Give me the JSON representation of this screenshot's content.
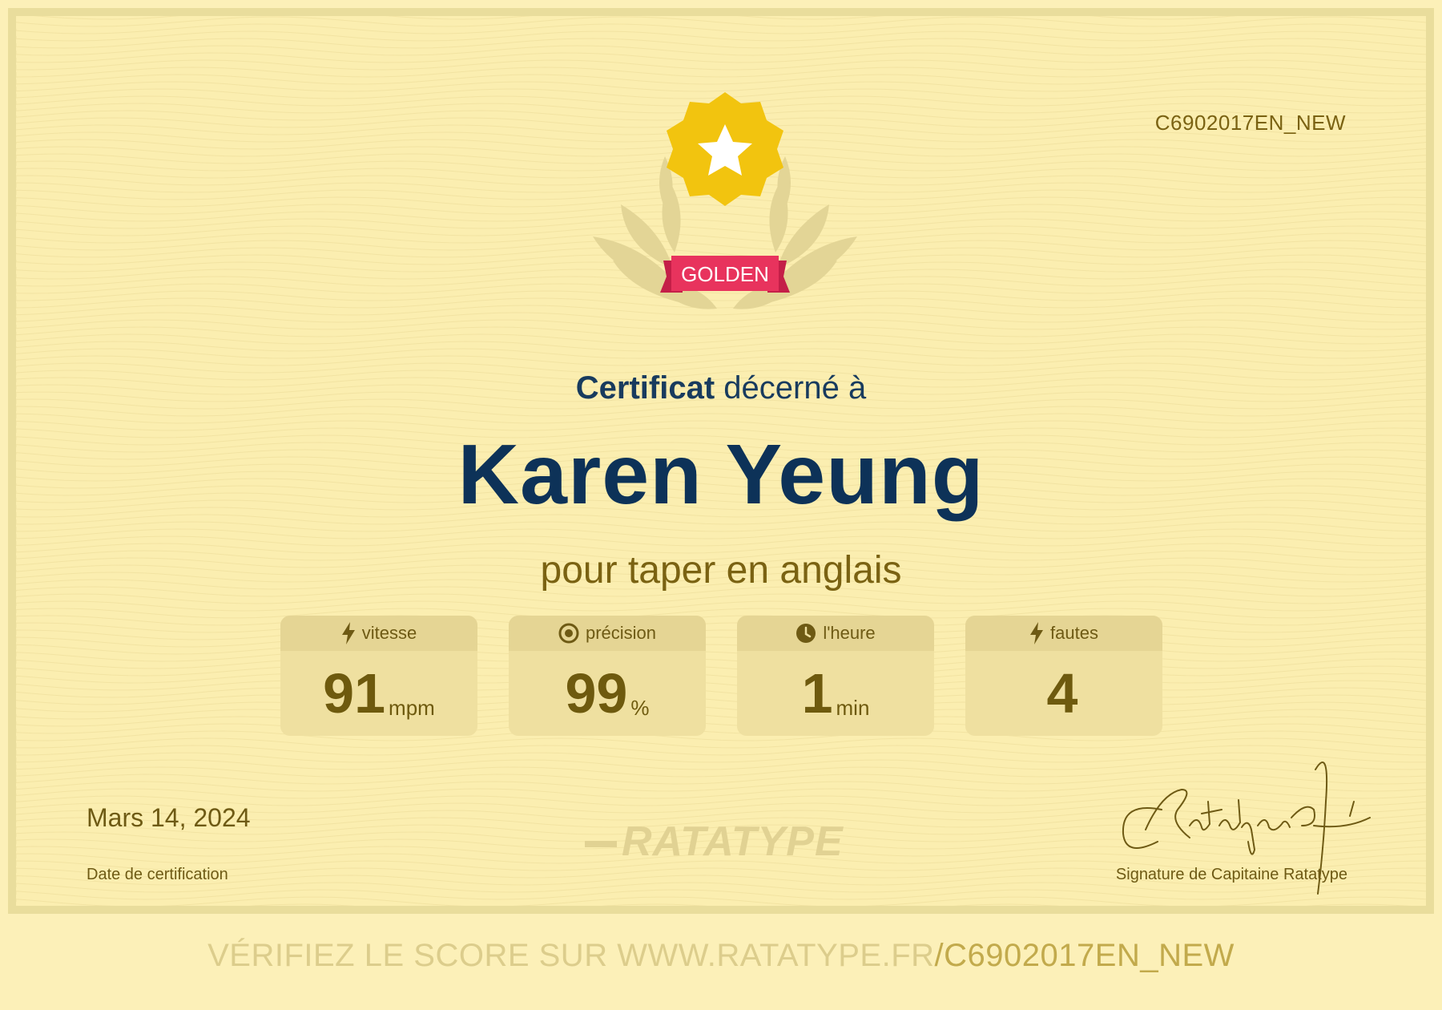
{
  "certificate_id": "C6902017EN_NEW",
  "badge": {
    "label": "GOLDEN"
  },
  "heading": {
    "bold": "Certificat",
    "rest": "décerné à"
  },
  "recipient_name": "Karen Yeung",
  "purpose": "pour taper en anglais",
  "stats": [
    {
      "label": "vitesse",
      "icon": "lightning-icon",
      "value": "91",
      "unit": "mpm"
    },
    {
      "label": "précision",
      "icon": "target-icon",
      "value": "99",
      "unit": "%"
    },
    {
      "label": "l'heure",
      "icon": "clock-icon",
      "value": "1",
      "unit": "min"
    },
    {
      "label": "fautes",
      "icon": "lightning-icon",
      "value": "4",
      "unit": ""
    }
  ],
  "date": {
    "value": "Mars 14, 2024",
    "label": "Date de certification"
  },
  "logo_text": "RATATYPE",
  "signature": {
    "label": "Signature de Capitaine Ratatype",
    "script_text": "CRatatypeFé"
  },
  "verify": {
    "prefix": "VÉRIFIEZ LE SCORE SUR WWW.RATATYPE.FR",
    "code": "/C6902017EN_NEW"
  },
  "colors": {
    "background": "#fbeeb0",
    "navy": "#0d3258",
    "olive": "#7a6212",
    "ribbon": "#e8335d",
    "star": "#f2c40f"
  }
}
